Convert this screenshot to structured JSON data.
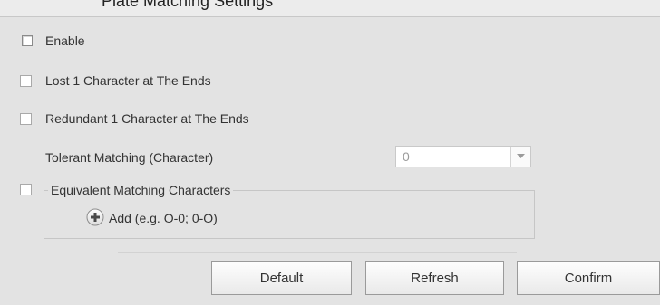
{
  "header": {
    "title": "Plate Matching Settings"
  },
  "form": {
    "enable_label": "Enable",
    "lost_label": "Lost 1 Character at The Ends",
    "redundant_label": "Redundant 1 Character at The Ends",
    "tolerant_label": "Tolerant Matching (Character)",
    "tolerant_value": "0",
    "equivalent_label": "Equivalent Matching Characters",
    "add_label": "Add (e.g. O-0; 0-O)"
  },
  "buttons": {
    "default_label": "Default",
    "refresh_label": "Refresh",
    "confirm_label": "Confirm"
  }
}
